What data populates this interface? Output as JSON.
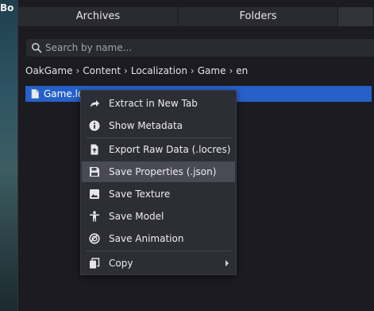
{
  "background": {
    "logo_fragment": "Bo"
  },
  "tabs": [
    {
      "label": "Archives"
    },
    {
      "label": "Folders"
    },
    {
      "label": ""
    }
  ],
  "search": {
    "placeholder": "Search by name...",
    "value": ""
  },
  "breadcrumb": [
    "OakGame",
    "Content",
    "Localization",
    "Game",
    "en"
  ],
  "file": {
    "name": "Game.locres"
  },
  "context_menu": {
    "items": [
      {
        "label": "Extract in New Tab",
        "icon": "share-arrow-icon"
      },
      {
        "label": "Show Metadata",
        "icon": "info-icon"
      },
      {
        "label": "Export Raw Data (.locres)",
        "icon": "file-export-icon"
      },
      {
        "label": "Save Properties (.json)",
        "icon": "save-icon"
      },
      {
        "label": "Save Texture",
        "icon": "image-icon"
      },
      {
        "label": "Save Model",
        "icon": "person-icon"
      },
      {
        "label": "Save Animation",
        "icon": "animation-icon"
      },
      {
        "label": "Copy",
        "icon": "copy-icon"
      }
    ]
  },
  "colors": {
    "selection": "#2660c9",
    "menu_hover": "#4a4a55",
    "panel": "#1b1b21"
  }
}
